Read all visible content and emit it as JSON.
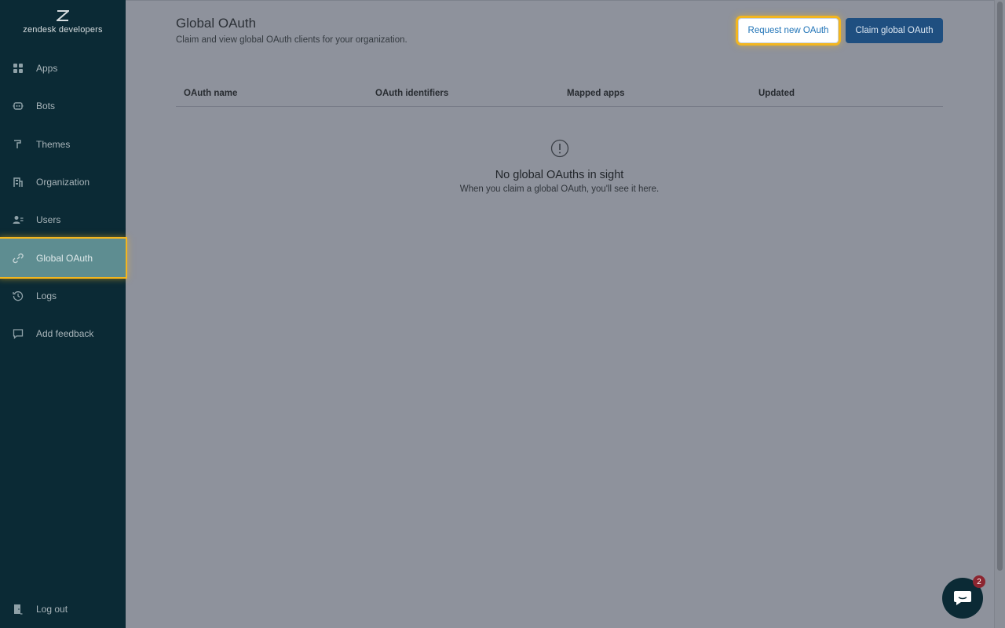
{
  "brand": {
    "logo_icon": "zendesk-logo-icon",
    "name": "zendesk developers"
  },
  "sidebar": {
    "items": [
      {
        "label": "Apps",
        "icon": "apps-grid-icon"
      },
      {
        "label": "Bots",
        "icon": "bot-icon"
      },
      {
        "label": "Themes",
        "icon": "paint-roller-icon"
      },
      {
        "label": "Organization",
        "icon": "building-icon"
      },
      {
        "label": "Users",
        "icon": "users-icon"
      },
      {
        "label": "Global OAuth",
        "icon": "link-icon",
        "active": true
      },
      {
        "label": "Logs",
        "icon": "history-icon"
      },
      {
        "label": "Add feedback",
        "icon": "speech-bubble-icon"
      }
    ],
    "logout_label": "Log out"
  },
  "header": {
    "title": "Global OAuth",
    "subtitle": "Claim and view global OAuth clients for your organization.",
    "request_button": "Request new OAuth",
    "claim_button": "Claim global OAuth"
  },
  "table": {
    "columns": [
      "OAuth name",
      "OAuth identifiers",
      "Mapped apps",
      "Updated"
    ],
    "rows": []
  },
  "empty_state": {
    "icon": "alert-circle-icon",
    "title": "No global OAuths in sight",
    "message": "When you claim a global OAuth, you'll see it here."
  },
  "chat_widget": {
    "icon": "chat-bubble-icon",
    "unread_count": "2"
  },
  "colors": {
    "sidebar_bg": "#0b2a35",
    "active_item_bg": "#5e8d91",
    "highlight": "#f3b61f",
    "primary_button": "#1f4f80",
    "link_blue": "#1f73b7",
    "overlay_bg": "#8e929c"
  }
}
